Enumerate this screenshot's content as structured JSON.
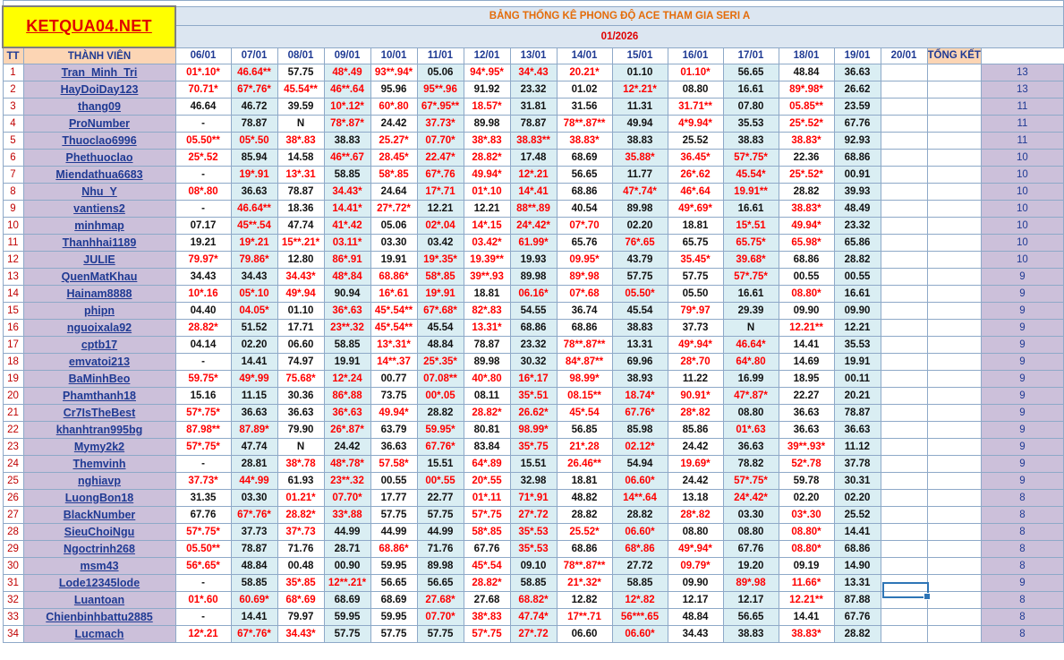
{
  "logo": {
    "text": "KETQUA04.NET"
  },
  "title": "BẢNG THỐNG KÊ PHONG ĐỘ ACE THAM GIA SERI A",
  "month": "01/2026",
  "headers": {
    "tt": "TT",
    "member": "THÀNH VIÊN",
    "total": "TỔNG KẾT"
  },
  "dates": [
    "06/01",
    "07/01",
    "08/01",
    "09/01",
    "10/01",
    "11/01",
    "12/01",
    "13/01",
    "14/01",
    "15/01",
    "16/01",
    "17/01",
    "18/01",
    "19/01",
    "20/01"
  ],
  "rows": [
    {
      "tt": "1",
      "name": "Tran_Minh_Tri",
      "cells": [
        "01*.10*",
        "46.64**",
        "57.75",
        "48*.49",
        "93**.94*",
        "05.06",
        "94*.95*",
        "34*.43",
        "20.21*",
        "01.10",
        "01.10*",
        "56.65",
        "48.84",
        "36.63",
        ""
      ],
      "total": "13"
    },
    {
      "tt": "2",
      "name": "HayDoiDay123",
      "cells": [
        "70.71*",
        "67*.76*",
        "45.54**",
        "46**.64",
        "95.96",
        "95**.96",
        "91.92",
        "23.32",
        "01.02",
        "12*.21*",
        "08.80",
        "16.61",
        "89*.98*",
        "26.62",
        ""
      ],
      "total": "13"
    },
    {
      "tt": "3",
      "name": "thang09",
      "cells": [
        "46.64",
        "46.72",
        "39.59",
        "10*.12*",
        "60*.80",
        "67*.95**",
        "18.57*",
        "31.81",
        "31.56",
        "11.31",
        "31.71**",
        "07.80",
        "05.85**",
        "23.59",
        ""
      ],
      "total": "11"
    },
    {
      "tt": "4",
      "name": "ProNumber",
      "cells": [
        "-",
        "78.87",
        "N",
        "78*.87*",
        "24.42",
        "37.73*",
        "89.98",
        "78.87",
        "78**.87**",
        "49.94",
        "4*9.94*",
        "35.53",
        "25*.52*",
        "67.76",
        ""
      ],
      "total": "11"
    },
    {
      "tt": "5",
      "name": "Thuoclao6996",
      "cells": [
        "05.50**",
        "05*.50",
        "38*.83",
        "38.83",
        "25.27*",
        "07.70*",
        "38*.83",
        "38.83**",
        "38.83*",
        "38.83",
        "25.52",
        "38.83",
        "38.83*",
        "92.93",
        ""
      ],
      "total": "11"
    },
    {
      "tt": "6",
      "name": "Phethuoclao",
      "cells": [
        "25*.52",
        "85.94",
        "14.58",
        "46**.67",
        "28.45*",
        "22.47*",
        "28.82*",
        "17.48",
        "68.69",
        "35.88*",
        "36.45*",
        "57*.75*",
        "22.36",
        "68.86",
        ""
      ],
      "total": "10"
    },
    {
      "tt": "7",
      "name": "Miendathua6683",
      "cells": [
        "-",
        "19*.91",
        "13*.31",
        "58.85",
        "58*.85",
        "67*.76",
        "49.94*",
        "12*.21",
        "56.65",
        "11.77",
        "26*.62",
        "45.54*",
        "25*.52*",
        "00.91",
        ""
      ],
      "total": "10"
    },
    {
      "tt": "8",
      "name": "Nhu_Y",
      "cells": [
        "08*.80",
        "36.63",
        "78.87",
        "34.43*",
        "24.64",
        "17*.71",
        "01*.10",
        "14*.41",
        "68.86",
        "47*.74*",
        "46*.64",
        "19.91**",
        "28.82",
        "39.93",
        ""
      ],
      "total": "10"
    },
    {
      "tt": "9",
      "name": "vantiens2",
      "cells": [
        "-",
        "46.64**",
        "18.36",
        "14.41*",
        "27*.72*",
        "12.21",
        "12.21",
        "88**.89",
        "40.54",
        "89.98",
        "49*.69*",
        "16.61",
        "38.83*",
        "48.49",
        ""
      ],
      "total": "10"
    },
    {
      "tt": "10",
      "name": "minhmap",
      "cells": [
        "07.17",
        "45**.54",
        "47.74",
        "41*.42",
        "05.06",
        "02*.04",
        "14*.15",
        "24*.42*",
        "07*.70",
        "02.20",
        "18.81",
        "15*.51",
        "49.94*",
        "23.32",
        ""
      ],
      "total": "10"
    },
    {
      "tt": "11",
      "name": "Thanhhai1189",
      "cells": [
        "19.21",
        "19*.21",
        "15**.21*",
        "03.11*",
        "03.30",
        "03.42",
        "03.42*",
        "61.99*",
        "65.76",
        "76*.65",
        "65.75",
        "65.75*",
        "65.98*",
        "65.86",
        ""
      ],
      "total": "10"
    },
    {
      "tt": "12",
      "name": "JULIE",
      "cells": [
        "79.97*",
        "79.86*",
        "12.80",
        "86*.91",
        "19.91",
        "19*.35*",
        "19.39**",
        "19.93",
        "09.95*",
        "43.79",
        "35.45*",
        "39.68*",
        "68.86",
        "28.82",
        ""
      ],
      "total": "10"
    },
    {
      "tt": "13",
      "name": "QuenMatKhau",
      "cells": [
        "34.43",
        "34.43",
        "34.43*",
        "48*.84",
        "68.86*",
        "58*.85",
        "39**.93",
        "89.98",
        "89*.98",
        "57.75",
        "57.75",
        "57*.75*",
        "00.55",
        "00.55",
        ""
      ],
      "total": "9"
    },
    {
      "tt": "14",
      "name": "Hainam8888",
      "cells": [
        "10*.16",
        "05*.10",
        "49*.94",
        "90.94",
        "16*.61",
        "19*.91",
        "18.81",
        "06.16*",
        "07*.68",
        "05.50*",
        "05.50",
        "16.61",
        "08.80*",
        "16.61",
        ""
      ],
      "total": "9"
    },
    {
      "tt": "15",
      "name": "phipn",
      "cells": [
        "04.40",
        "04.05*",
        "01.10",
        "36*.63",
        "45*.54**",
        "67*.68*",
        "82*.83",
        "54.55",
        "36.74",
        "45.54",
        "79*.97",
        "29.39",
        "09.90",
        "09.90",
        ""
      ],
      "total": "9"
    },
    {
      "tt": "16",
      "name": "nguoixala92",
      "cells": [
        "28.82*",
        "51.52",
        "17.71",
        "23**.32",
        "45*.54**",
        "45.54",
        "13.31*",
        "68.86",
        "68.86",
        "38.83",
        "37.73",
        "N",
        "12.21**",
        "12.21",
        ""
      ],
      "total": "9"
    },
    {
      "tt": "17",
      "name": "cptb17",
      "cells": [
        "04.14",
        "02.20",
        "06.60",
        "58.85",
        "13*.31*",
        "48.84",
        "78.87",
        "23.32",
        "78**.87**",
        "13.31",
        "49*.94*",
        "46.64*",
        "14.41",
        "35.53",
        ""
      ],
      "total": "9"
    },
    {
      "tt": "18",
      "name": "emvatoi213",
      "cells": [
        "-",
        "14.41",
        "74.97",
        "19.91",
        "14**.37",
        "25*.35*",
        "89.98",
        "30.32",
        "84*.87**",
        "69.96",
        "28*.70",
        "64*.80",
        "14.69",
        "19.91",
        ""
      ],
      "total": "9"
    },
    {
      "tt": "19",
      "name": "BaMinhBeo",
      "cells": [
        "59.75*",
        "49*.99",
        "75.68*",
        "12*.24",
        "00.77",
        "07.08**",
        "40*.80",
        "16*.17",
        "98.99*",
        "38.93",
        "11.22",
        "16.99",
        "18.95",
        "00.11",
        ""
      ],
      "total": "9"
    },
    {
      "tt": "20",
      "name": "Phamthanh18",
      "cells": [
        "15.16",
        "11.15",
        "30.36",
        "86*.88",
        "73.75",
        "00*.05",
        "08.11",
        "35*.51",
        "08.15**",
        "18.74*",
        "90.91*",
        "47*.87*",
        "22.27",
        "20.21",
        ""
      ],
      "total": "9"
    },
    {
      "tt": "21",
      "name": "Cr7IsTheBest",
      "cells": [
        "57*.75*",
        "36.63",
        "36.63",
        "36*.63",
        "49.94*",
        "28.82",
        "28.82*",
        "26.62*",
        "45*.54",
        "67.76*",
        "28*.82",
        "08.80",
        "36.63",
        "78.87",
        ""
      ],
      "total": "9"
    },
    {
      "tt": "22",
      "name": "khanhtran995bg",
      "cells": [
        "87.98**",
        "87.89*",
        "79.90",
        "26*.87*",
        "63.79",
        "59.95*",
        "80.81",
        "98.99*",
        "56.85",
        "85.98",
        "85.86",
        "01*.63",
        "36.63",
        "36.63",
        ""
      ],
      "total": "9"
    },
    {
      "tt": "23",
      "name": "Mymy2k2",
      "cells": [
        "57*.75*",
        "47.74",
        "N",
        "24.42",
        "36.63",
        "67.76*",
        "83.84",
        "35*.75",
        "21*.28",
        "02.12*",
        "24.42",
        "36.63",
        "39**.93*",
        "11.12",
        ""
      ],
      "total": "9"
    },
    {
      "tt": "24",
      "name": "Themvinh",
      "cells": [
        "-",
        "28.81",
        "38*.78",
        "48*.78*",
        "57.58*",
        "15.51",
        "64*.89",
        "15.51",
        "26.46**",
        "54.94",
        "19.69*",
        "78.82",
        "52*.78",
        "37.78",
        ""
      ],
      "total": "9"
    },
    {
      "tt": "25",
      "name": "nghiavp",
      "cells": [
        "37.73*",
        "44*.99",
        "61.93",
        "23**.32",
        "00.55",
        "00*.55",
        "20*.55",
        "32.98",
        "18.81",
        "06.60*",
        "24.42",
        "57*.75*",
        "59.78",
        "30.31",
        ""
      ],
      "total": "9"
    },
    {
      "tt": "26",
      "name": "LuongBon18",
      "cells": [
        "31.35",
        "03.30",
        "01.21*",
        "07.70*",
        "17.77",
        "22.77",
        "01*.11",
        "71*.91",
        "48.82",
        "14**.64",
        "13.18",
        "24*.42*",
        "02.20",
        "02.20",
        ""
      ],
      "total": "8"
    },
    {
      "tt": "27",
      "name": "BlackNumber",
      "cells": [
        "67.76",
        "67*.76*",
        "28.82*",
        "33*.88",
        "57.75",
        "57.75",
        "57*.75",
        "27*.72",
        "28.82",
        "28.82",
        "28*.82",
        "03.30",
        "03*.30",
        "25.52",
        ""
      ],
      "total": "8"
    },
    {
      "tt": "28",
      "name": "SieuChoiNgu",
      "cells": [
        "57*.75*",
        "37.73",
        "37*.73",
        "44.99",
        "44.99",
        "44.99",
        "58*.85",
        "35*.53",
        "25.52*",
        "06.60*",
        "08.80",
        "08.80",
        "08.80*",
        "14.41",
        ""
      ],
      "total": "8"
    },
    {
      "tt": "29",
      "name": "Ngoctrinh268",
      "cells": [
        "05.50**",
        "78.87",
        "71.76",
        "28.71",
        "68.86*",
        "71.76",
        "67.76",
        "35*.53",
        "68.86",
        "68*.86",
        "49*.94*",
        "67.76",
        "08.80*",
        "68.86",
        ""
      ],
      "total": "8"
    },
    {
      "tt": "30",
      "name": "msm43",
      "cells": [
        "56*.65*",
        "48.84",
        "00.48",
        "00.90",
        "59.95",
        "89.98",
        "45*.54",
        "09.10",
        "78**.87**",
        "27.72",
        "09.79*",
        "19.20",
        "09.19",
        "14.90",
        ""
      ],
      "total": "8"
    },
    {
      "tt": "31",
      "name": "Lode12345lode",
      "cells": [
        "-",
        "58.85",
        "35*.85",
        "12**.21*",
        "56.65",
        "56.65",
        "28.82*",
        "58.85",
        "21*.32*",
        "58.85",
        "09.90",
        "89*.98",
        "11.66*",
        "13.31",
        ""
      ],
      "total": "9"
    },
    {
      "tt": "32",
      "name": "Luantoan",
      "cells": [
        "01*.60",
        "60.69*",
        "68*.69",
        "68.69",
        "68.69",
        "27.68*",
        "27.68",
        "68.82*",
        "12.82",
        "12*.82",
        "12.17",
        "12.17",
        "12.21**",
        "87.88",
        ""
      ],
      "total": "8"
    },
    {
      "tt": "33",
      "name": "Chienbinhbattu2885",
      "cells": [
        "-",
        "14.41",
        "79.97",
        "59.95",
        "59.95",
        "07.70*",
        "38*.83",
        "47.74*",
        "17**.71",
        "56***.65",
        "48.84",
        "56.65",
        "14.41",
        "67.76",
        ""
      ],
      "total": "8"
    },
    {
      "tt": "34",
      "name": "Lucmach",
      "cells": [
        "12*.21",
        "67*.76*",
        "34.43*",
        "57.75",
        "57.75",
        "57.75",
        "57*.75",
        "27*.72",
        "06.60",
        "06.60*",
        "34.43",
        "38.83",
        "38.83*",
        "28.82",
        ""
      ],
      "total": "8"
    }
  ]
}
